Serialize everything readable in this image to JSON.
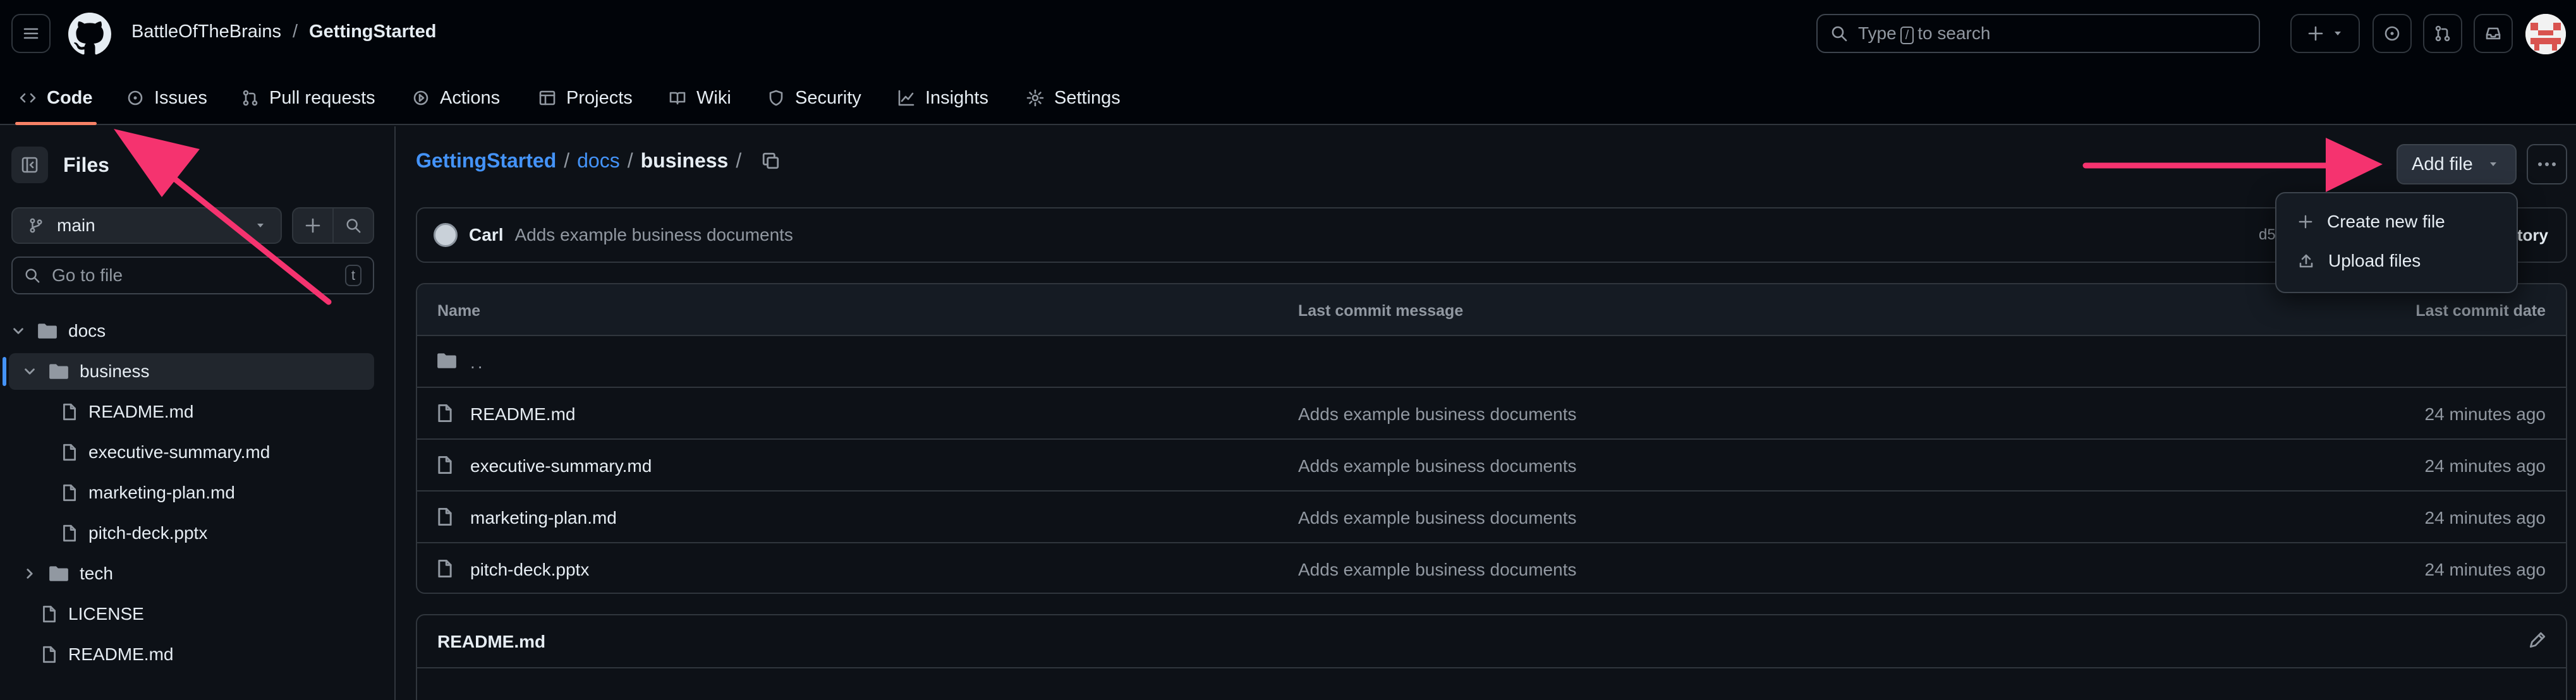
{
  "header": {
    "owner": "BattleOfTheBrains",
    "separator": "/",
    "repo": "GettingStarted",
    "search_prefix": "Type",
    "search_key": "/",
    "search_suffix": "to search"
  },
  "tabs": [
    {
      "label": "Code",
      "icon": "code-icon"
    },
    {
      "label": "Issues",
      "icon": "issue-icon"
    },
    {
      "label": "Pull requests",
      "icon": "pull-request-icon"
    },
    {
      "label": "Actions",
      "icon": "play-icon"
    },
    {
      "label": "Projects",
      "icon": "table-icon"
    },
    {
      "label": "Wiki",
      "icon": "book-icon"
    },
    {
      "label": "Security",
      "icon": "shield-icon"
    },
    {
      "label": "Insights",
      "icon": "graph-icon"
    },
    {
      "label": "Settings",
      "icon": "gear-icon"
    }
  ],
  "sidebar": {
    "title": "Files",
    "branch": "main",
    "goto_placeholder": "Go to file",
    "goto_key": "t",
    "tree": [
      {
        "label": "docs",
        "type": "folder",
        "expanded": true
      },
      {
        "label": "business",
        "type": "folder",
        "expanded": true,
        "selected": true
      },
      {
        "label": "README.md",
        "type": "file"
      },
      {
        "label": "executive-summary.md",
        "type": "file"
      },
      {
        "label": "marketing-plan.md",
        "type": "file"
      },
      {
        "label": "pitch-deck.pptx",
        "type": "file"
      },
      {
        "label": "tech",
        "type": "folder",
        "expanded": false
      },
      {
        "label": "LICENSE",
        "type": "file"
      },
      {
        "label": "README.md",
        "type": "file"
      }
    ]
  },
  "main": {
    "path": {
      "root": "GettingStarted",
      "sep": "/",
      "folder": "docs",
      "current": "business"
    },
    "add_file_label": "Add file",
    "commit": {
      "author": "Carl",
      "message": "Adds example business documents",
      "hash_partial": "d5",
      "history_partial": "tory"
    },
    "table": {
      "headers": {
        "name": "Name",
        "message": "Last commit message",
        "date": "Last commit date"
      },
      "parent": "..",
      "rows": [
        {
          "name": "README.md",
          "message": "Adds example business documents",
          "date": "24 minutes ago"
        },
        {
          "name": "executive-summary.md",
          "message": "Adds example business documents",
          "date": "24 minutes ago"
        },
        {
          "name": "marketing-plan.md",
          "message": "Adds example business documents",
          "date": "24 minutes ago"
        },
        {
          "name": "pitch-deck.pptx",
          "message": "Adds example business documents",
          "date": "24 minutes ago"
        }
      ]
    },
    "readme_title": "README.md"
  },
  "dropdown": {
    "items": [
      {
        "label": "Create new file",
        "icon": "plus-icon"
      },
      {
        "label": "Upload files",
        "icon": "upload-icon"
      }
    ]
  },
  "colors": {
    "accent_link": "#4493f8",
    "tab_underline": "#f78166",
    "annotation_arrow": "#f5336f"
  }
}
